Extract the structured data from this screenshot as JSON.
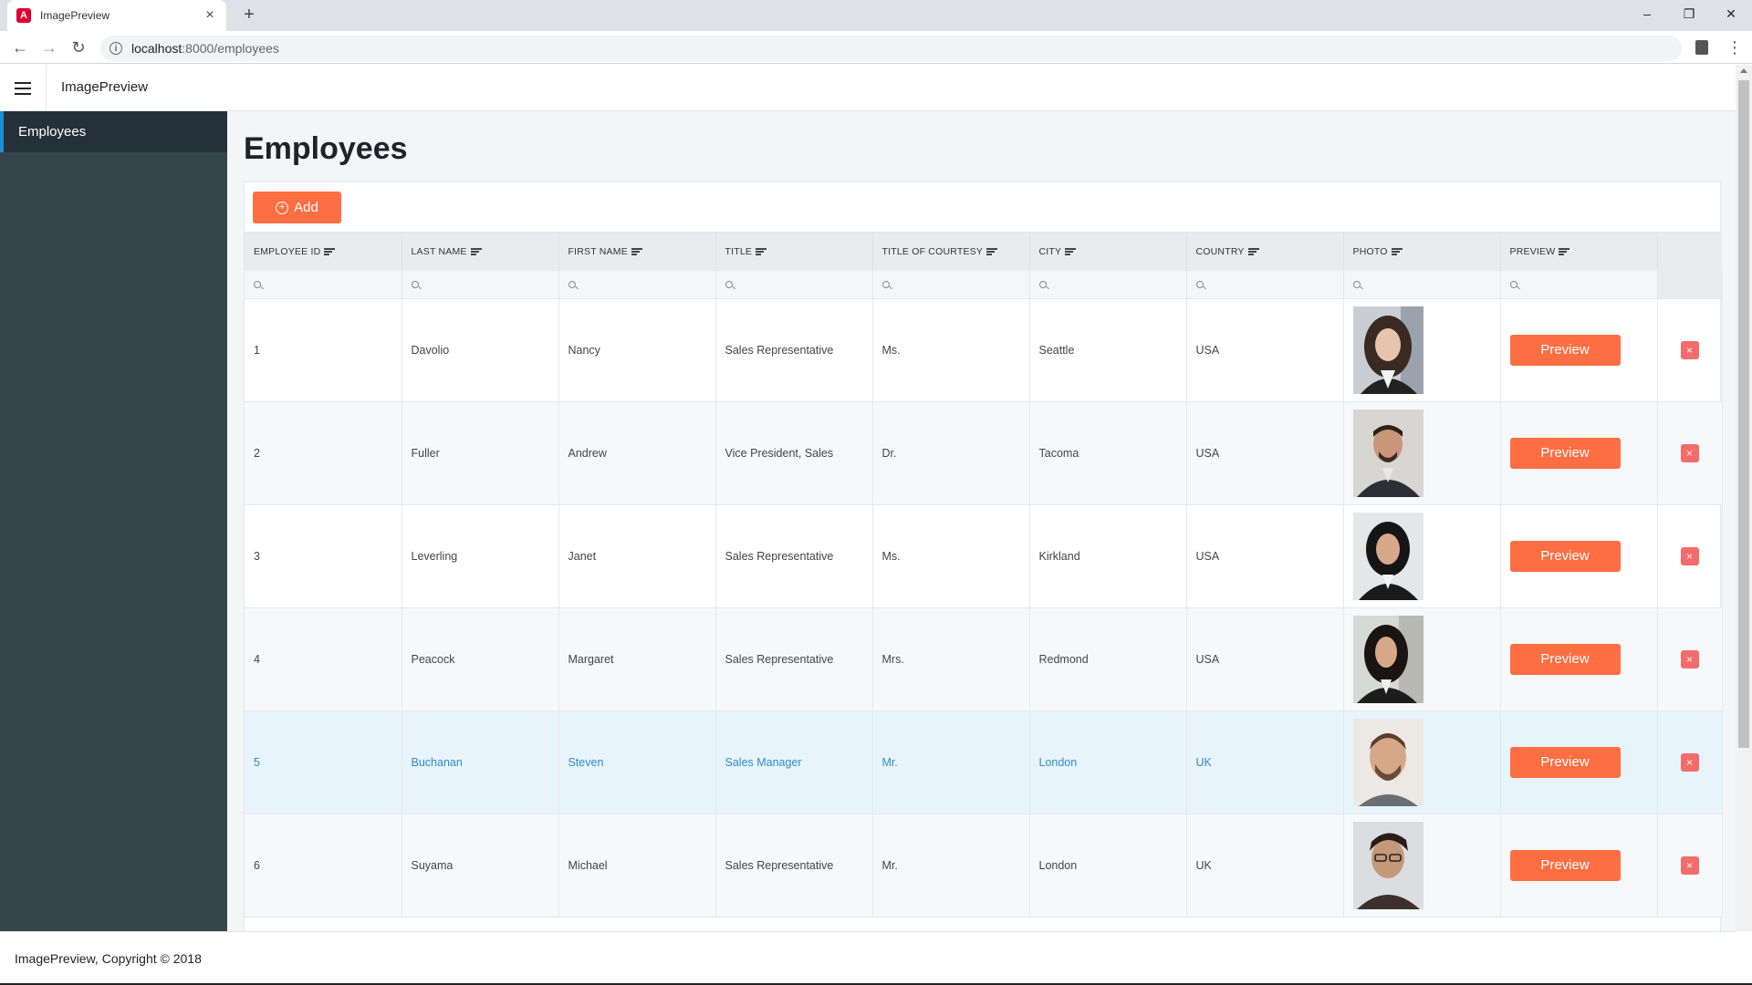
{
  "browser": {
    "tab_title": "ImagePreview",
    "tab_favicon": "A",
    "close_tab": "×",
    "new_tab": "+",
    "url_host": "localhost",
    "url_path": ":8000/employees",
    "window_controls": {
      "minimize": "–",
      "restore": "❐",
      "close": "✕"
    },
    "back": "←",
    "forward": "→",
    "reload": "↻",
    "menu": "⋮"
  },
  "app": {
    "title": "ImagePreview",
    "footer": "ImagePreview, Copyright © 2018"
  },
  "sidebar": {
    "items": [
      {
        "label": "Employees",
        "active": true
      }
    ]
  },
  "page": {
    "title": "Employees",
    "add_label": "Add"
  },
  "table": {
    "columns": [
      "Employee ID",
      "Last Name",
      "First Name",
      "Title",
      "Title of Courtesy",
      "City",
      "Country",
      "Photo",
      "Preview"
    ],
    "preview_label": "Preview",
    "delete_label": "×",
    "rows": [
      {
        "id": "1",
        "last": "Davolio",
        "first": "Nancy",
        "title": "Sales Representative",
        "courtesy": "Ms.",
        "city": "Seattle",
        "country": "USA"
      },
      {
        "id": "2",
        "last": "Fuller",
        "first": "Andrew",
        "title": "Vice President, Sales",
        "courtesy": "Dr.",
        "city": "Tacoma",
        "country": "USA"
      },
      {
        "id": "3",
        "last": "Leverling",
        "first": "Janet",
        "title": "Sales Representative",
        "courtesy": "Ms.",
        "city": "Kirkland",
        "country": "USA"
      },
      {
        "id": "4",
        "last": "Peacock",
        "first": "Margaret",
        "title": "Sales Representative",
        "courtesy": "Mrs.",
        "city": "Redmond",
        "country": "USA"
      },
      {
        "id": "5",
        "last": "Buchanan",
        "first": "Steven",
        "title": "Sales Manager",
        "courtesy": "Mr.",
        "city": "London",
        "country": "UK"
      },
      {
        "id": "6",
        "last": "Suyama",
        "first": "Michael",
        "title": "Sales Representative",
        "courtesy": "Mr.",
        "city": "London",
        "country": "UK"
      }
    ]
  },
  "colors": {
    "accent": "#fd6e42",
    "sidebar_bg": "#36444b",
    "selected_row": "#e8f4fb",
    "delete": "#f36b6b"
  }
}
